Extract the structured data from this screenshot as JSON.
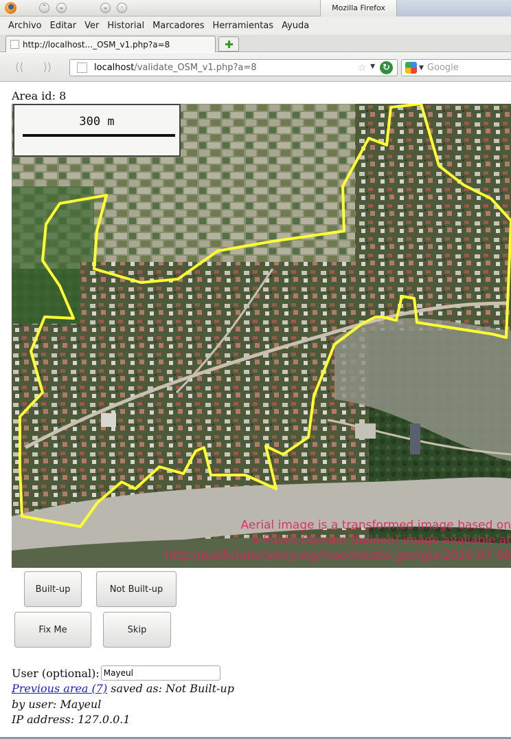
{
  "window": {
    "title": "Mozilla Firefox"
  },
  "menu": [
    "Archivo",
    "Editar",
    "Ver",
    "Historial",
    "Marcadores",
    "Herramientas",
    "Ayuda"
  ],
  "tab": {
    "title": "http://localhost..._OSM_v1.php?a=8"
  },
  "nav": {
    "url_host": "localhost",
    "url_path": "/validate_OSM_v1.php?a=8",
    "search_placeholder": "Google"
  },
  "page": {
    "area_title": "Area id: 8",
    "scale_label": "300 m",
    "attribution": [
      "Aerial image is a transformed image based on",
      "a Public Domain (baloon) image available at",
      "http://publiclaboratory.org/map/mestia-georgia/2010-07-08"
    ],
    "buttons": {
      "built_up": "Built-up",
      "not_built_up": "Not Built-up",
      "fix_me": "Fix Me",
      "skip": "Skip"
    },
    "user_label": "User (optional):",
    "user_value": "Mayeul",
    "previous_link": "Previous area (7)",
    "saved_as": " saved as: Not Built-up",
    "by_user": "by user: Mayeul",
    "ip_address": "IP address: 127.0.0.1"
  },
  "colors": {
    "polygon": "#ffff33",
    "attribution": "#e0225c",
    "link": "#1a1ad0"
  }
}
